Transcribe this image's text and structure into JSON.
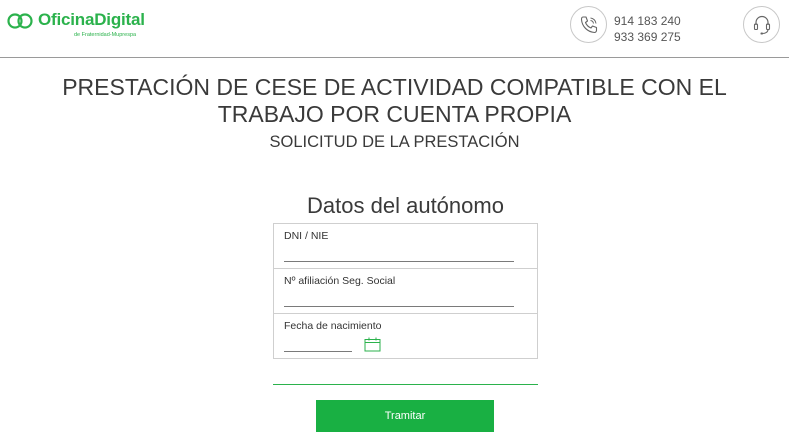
{
  "header": {
    "logo_text": "OficinaDigital",
    "logo_tagline": "de Fraternidad-Muprespa",
    "phone_1": "914 183 240",
    "phone_2": "933 369 275",
    "brand_color": "#2bb24c"
  },
  "page": {
    "title_line_1": "PRESTACIÓN DE CESE DE ACTIVIDAD COMPATIBLE CON EL",
    "title_line_2": "TRABAJO POR CUENTA PROPIA",
    "subtitle": "SOLICITUD DE LA PRESTACIÓN"
  },
  "form": {
    "section_title": "Datos del autónomo",
    "fields": [
      {
        "label": "DNI / NIE",
        "value": ""
      },
      {
        "label": "Nº afiliación Seg. Social",
        "value": ""
      },
      {
        "label": "Fecha de nacimiento",
        "value": "",
        "icon": "calendar-icon"
      }
    ],
    "submit_label": "Tramitar",
    "button_color": "#19b043"
  }
}
